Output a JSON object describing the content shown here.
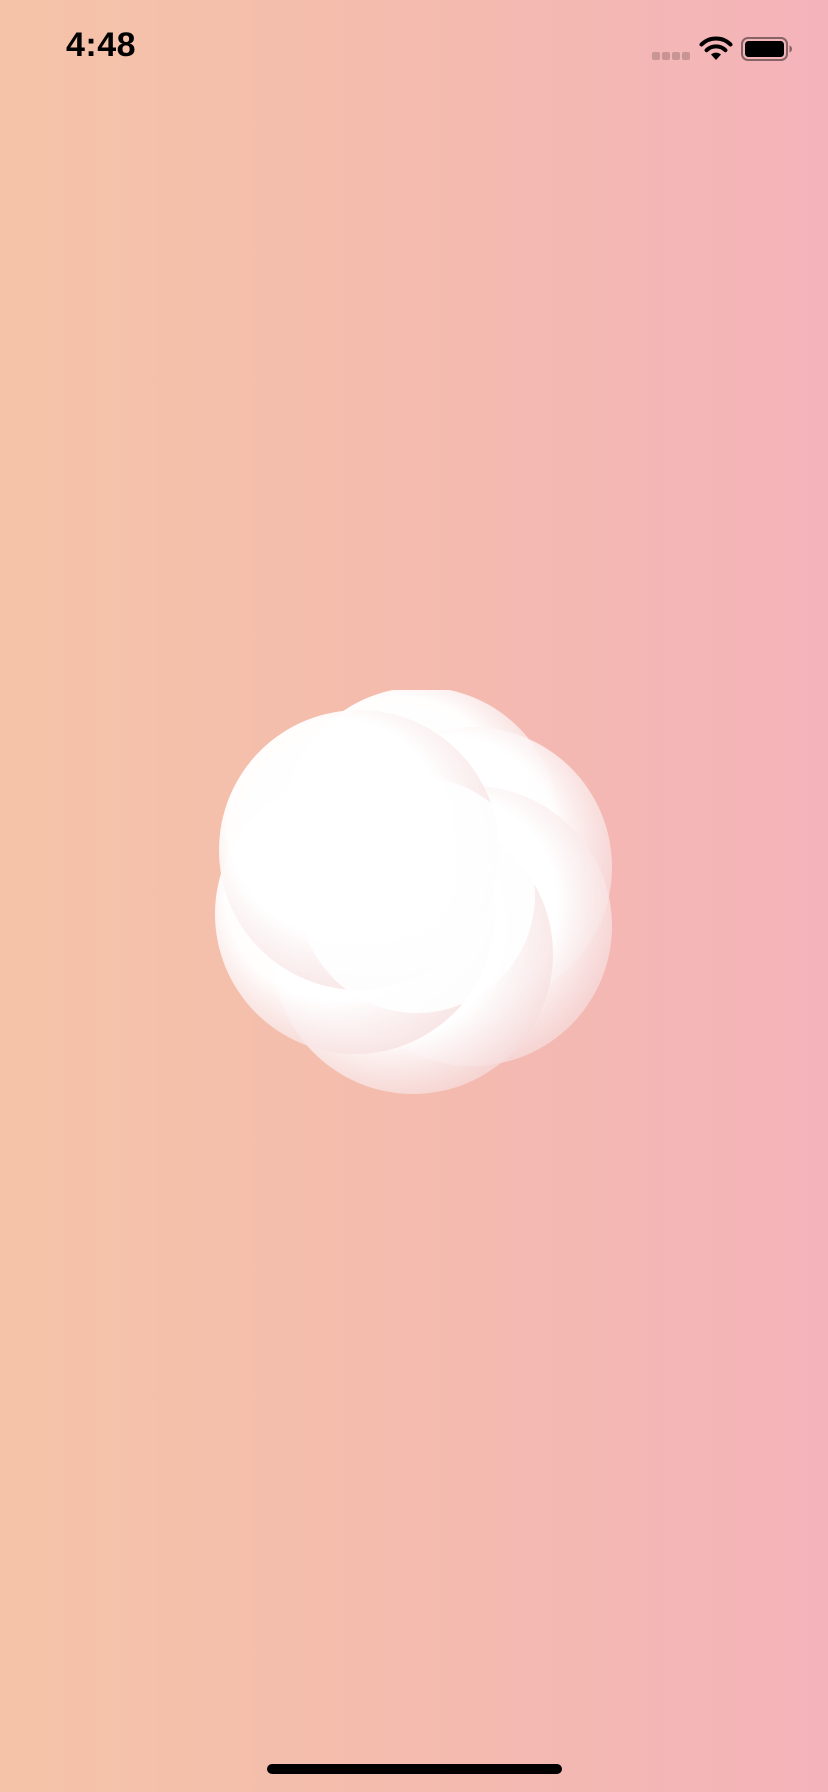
{
  "status_bar": {
    "time": "4:48",
    "signal_icon": "cellular-signal-icon",
    "wifi_icon": "wifi-icon",
    "battery_icon": "battery-icon"
  },
  "splash": {
    "logo_icon": "swirl-logo-icon",
    "background_colors": [
      "#f5c4a8",
      "#f4b3ba"
    ]
  },
  "home_indicator": {
    "color": "#000000"
  }
}
